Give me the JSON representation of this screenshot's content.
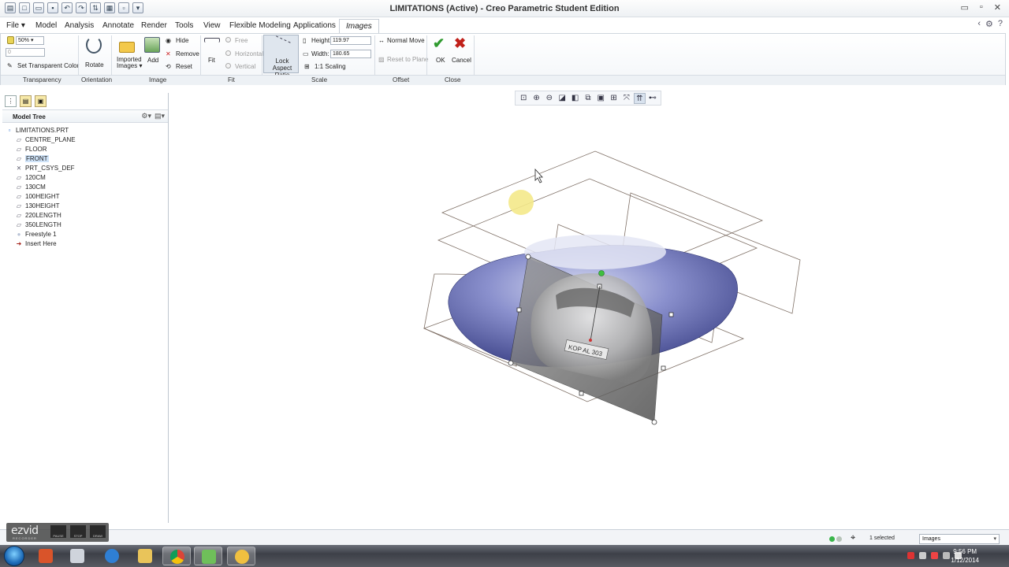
{
  "window": {
    "title": "LIMITATIONS (Active) - Creo Parametric Student Edition",
    "controls": [
      "▭",
      "▫",
      "✕"
    ]
  },
  "menu_tabs": [
    {
      "label": "File ▾"
    },
    {
      "label": "Model"
    },
    {
      "label": "Analysis"
    },
    {
      "label": "Annotate"
    },
    {
      "label": "Render"
    },
    {
      "label": "Tools"
    },
    {
      "label": "View"
    },
    {
      "label": "Flexible Modeling"
    },
    {
      "label": "Applications"
    },
    {
      "label": "Images"
    }
  ],
  "ribbon": {
    "transparency": {
      "value": "50%",
      "spinner_value": "0",
      "set_transparent_color": "Set Transparent Color",
      "group_label": "Transparency"
    },
    "orientation": {
      "rotate": "Rotate",
      "group_label": "Orientation"
    },
    "image": {
      "imported_images": "Imported Images ▾",
      "add": "Add",
      "hide": "Hide",
      "remove": "Remove",
      "reset": "Reset",
      "group_label": "Image"
    },
    "fit": {
      "fit": "Fit",
      "free": "Free",
      "horizontal": "Horizontal",
      "vertical": "Vertical",
      "group_label": "Fit"
    },
    "scale": {
      "lock_aspect_ratio": "Lock Aspect Ratio",
      "height_label": "Height:",
      "height_value": "119.97",
      "width_label": "Width:",
      "width_value": "180.65",
      "scaling": "1:1 Scaling",
      "group_label": "Scale"
    },
    "offset": {
      "normal_move": "Normal Move",
      "reset_to_plane": "Reset to Plane",
      "group_label": "Offset"
    },
    "close": {
      "ok": "OK",
      "cancel": "Cancel",
      "group_label": "Close"
    }
  },
  "model_tree": {
    "header": "Model Tree",
    "items": [
      {
        "label": "LIMITATIONS.PRT",
        "icon": "part-icon"
      },
      {
        "label": "CENTRE_PLANE",
        "icon": "datum-plane-icon"
      },
      {
        "label": "FLOOR",
        "icon": "datum-plane-icon"
      },
      {
        "label": "FRONT",
        "icon": "datum-plane-icon",
        "selected": true
      },
      {
        "label": "PRT_CSYS_DEF",
        "icon": "coordinate-system-icon"
      },
      {
        "label": "120CM",
        "icon": "datum-plane-icon"
      },
      {
        "label": "130CM",
        "icon": "datum-plane-icon"
      },
      {
        "label": "100HEIGHT",
        "icon": "datum-plane-icon"
      },
      {
        "label": "130HEIGHT",
        "icon": "datum-plane-icon"
      },
      {
        "label": "220LENGTH",
        "icon": "datum-plane-icon"
      },
      {
        "label": "350LENGTH",
        "icon": "datum-plane-icon"
      },
      {
        "label": "Freestyle 1",
        "icon": "freestyle-icon"
      },
      {
        "label": "Insert Here",
        "icon": "insert-arrow-icon"
      }
    ]
  },
  "graphics": {
    "license_plate": "KOP AL 303"
  },
  "status": {
    "selected": "1 selected",
    "filter": "Images"
  },
  "recorder": {
    "logo": "ezvid",
    "subtitle": "RECORDER",
    "buttons": [
      "PAUSE",
      "STOP",
      "DRAW"
    ]
  },
  "taskbar": {
    "time": "9:56 PM",
    "date": "1/12/2014"
  },
  "colors": {
    "ok_green": "#2f9a2f",
    "cancel_red": "#c0201a",
    "body_blue": "#7f86c7",
    "selection_bg": "#cfe3f8"
  }
}
